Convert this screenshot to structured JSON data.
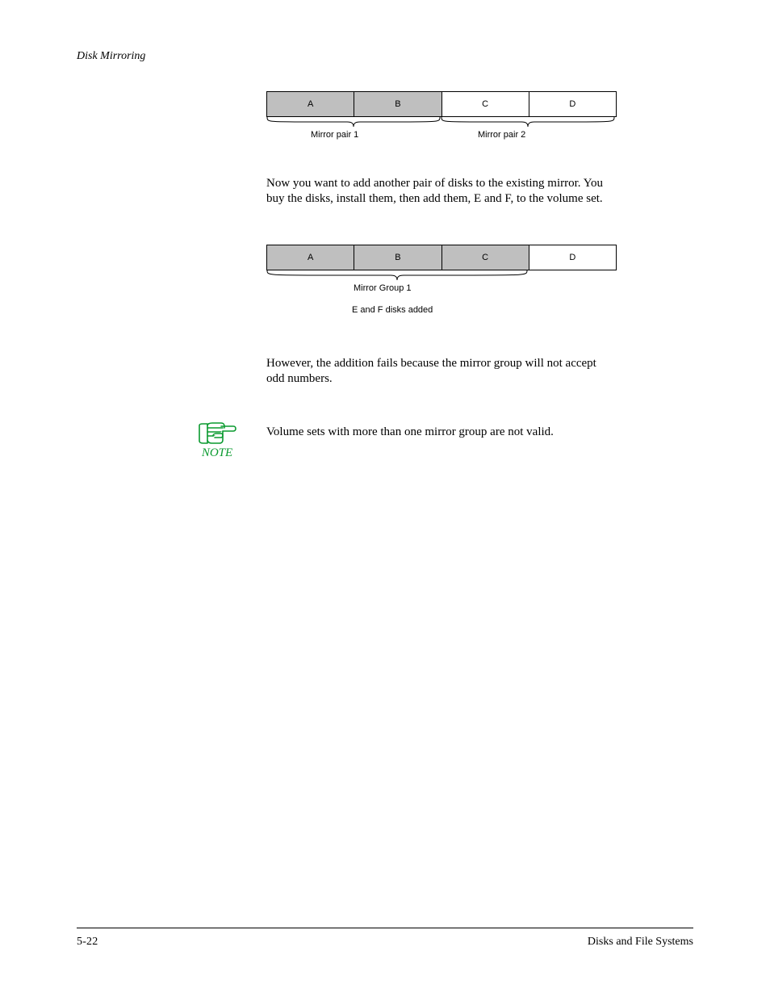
{
  "header": {
    "title": "Disk Mirroring"
  },
  "diagram1": {
    "cells": [
      "A",
      "B",
      "C",
      "D"
    ],
    "label_left": "Mirror pair 1",
    "label_right": "Mirror pair 2"
  },
  "para1": "Now you want to add another pair of disks to the existing mirror. You buy the disks, install them, then add them, E and F, to the volume set.",
  "diagram2": {
    "cells": [
      "A",
      "B",
      "C",
      "D"
    ],
    "label_main": "Mirror Group 1",
    "label_sub": "E   and   F   disks   added"
  },
  "para2": "However, the addition fails because the mirror group will not accept odd numbers.",
  "note": "Volume sets with more than one mirror group are not valid.",
  "footer": {
    "left": "5-22",
    "right": "Disks and File Systems"
  }
}
